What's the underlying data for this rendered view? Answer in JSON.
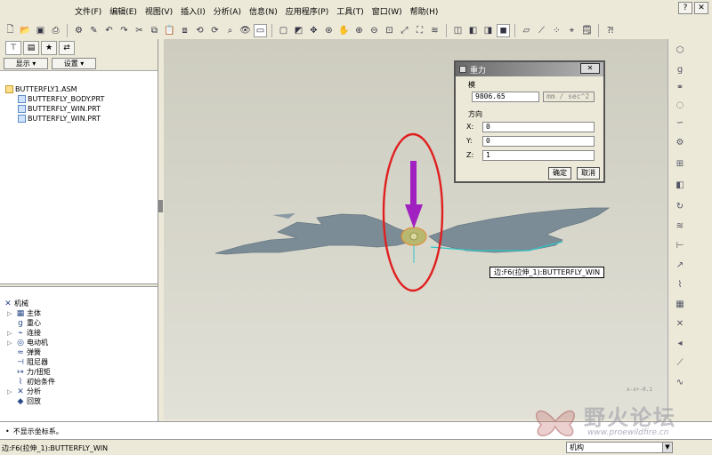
{
  "menu": {
    "items": [
      "文件(F)",
      "编辑(E)",
      "视图(V)",
      "插入(I)",
      "分析(A)",
      "信息(N)",
      "应用程序(P)",
      "工具(T)",
      "窗口(W)",
      "帮助(H)"
    ]
  },
  "panel": {
    "show_label": "显示 ▾",
    "settings_label": "设置 ▾"
  },
  "model_tree": [
    {
      "label": "BUTTERFLY1.ASM",
      "type": "asm"
    },
    {
      "label": "BUTTERFLY_BODY.PRT",
      "type": "prt"
    },
    {
      "label": "BUTTERFLY_WIN.PRT",
      "type": "prt"
    },
    {
      "label": "BUTTERFLY_WIN.PRT",
      "type": "prt"
    }
  ],
  "mech_tree": [
    {
      "label": "机械",
      "icon": "✕",
      "expand": ""
    },
    {
      "label": "主体",
      "icon": "▦",
      "expand": "▷"
    },
    {
      "label": "重心",
      "icon": "g",
      "expand": ""
    },
    {
      "label": "连接",
      "icon": "⌁",
      "expand": "▷"
    },
    {
      "label": "电动机",
      "icon": "◎",
      "expand": "▷"
    },
    {
      "label": "弹簧",
      "icon": "≈",
      "expand": ""
    },
    {
      "label": "阻尼器",
      "icon": "⊣",
      "expand": ""
    },
    {
      "label": "力/扭矩",
      "icon": "↦",
      "expand": ""
    },
    {
      "label": "初始条件",
      "icon": "⌇",
      "expand": ""
    },
    {
      "label": "分析",
      "icon": "✕",
      "expand": "▷"
    },
    {
      "label": "回放",
      "icon": "◆",
      "expand": ""
    }
  ],
  "dialog": {
    "title": "重力",
    "modulus_label": "模",
    "modulus_value": "9806.65",
    "unit": "mm / sec^2",
    "direction_label": "方向",
    "x_label": "X:",
    "x_value": "0",
    "y_label": "Y:",
    "y_value": "0",
    "z_label": "Z:",
    "z_value": "1",
    "ok_label": "确定",
    "cancel_label": "取消",
    "close_label": "✕"
  },
  "tooltip": "边:F6(拉伸_1):BUTTERFLY_WIN",
  "message": "不显示坐标系。",
  "status": "边:F6(拉伸_1):BUTTERFLY_WIN",
  "filter_value": "机构",
  "watermark": {
    "text": "野火论坛",
    "url": "www.proewildfire.cn"
  },
  "colors": {
    "arrow": "#a020c0",
    "highlight_circle": "#e02020",
    "wing": "#7b8c96"
  }
}
